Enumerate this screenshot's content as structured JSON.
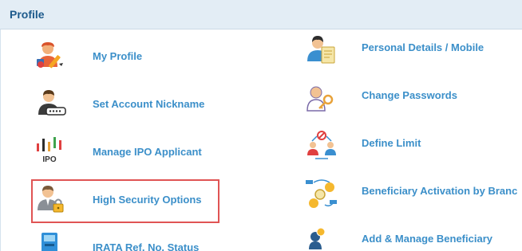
{
  "header": {
    "title": "Profile"
  },
  "left_items": [
    {
      "label": "My Profile",
      "icon": "user-edit-icon"
    },
    {
      "label": "Set Account Nickname",
      "icon": "user-nickname-icon"
    },
    {
      "label": "Manage IPO Applicant",
      "icon": "ipo-chart-icon"
    },
    {
      "label": "High Security Options",
      "icon": "user-lock-icon"
    },
    {
      "label": "IRATA Ref. No. Status",
      "icon": "atm-machine-icon"
    }
  ],
  "right_items": [
    {
      "label": "Personal Details / Mobile",
      "icon": "personal-details-icon"
    },
    {
      "label": "Change Passwords",
      "icon": "user-key-icon"
    },
    {
      "label": "Define Limit",
      "icon": "define-limit-icon"
    },
    {
      "label": "Beneficiary Activation by Branc",
      "icon": "beneficiary-activation-icon"
    },
    {
      "label": "Add & Manage Beneficiary",
      "icon": "add-beneficiary-icon"
    }
  ],
  "highlight_color": "#e05454",
  "accent_color": "#3b8fc9"
}
